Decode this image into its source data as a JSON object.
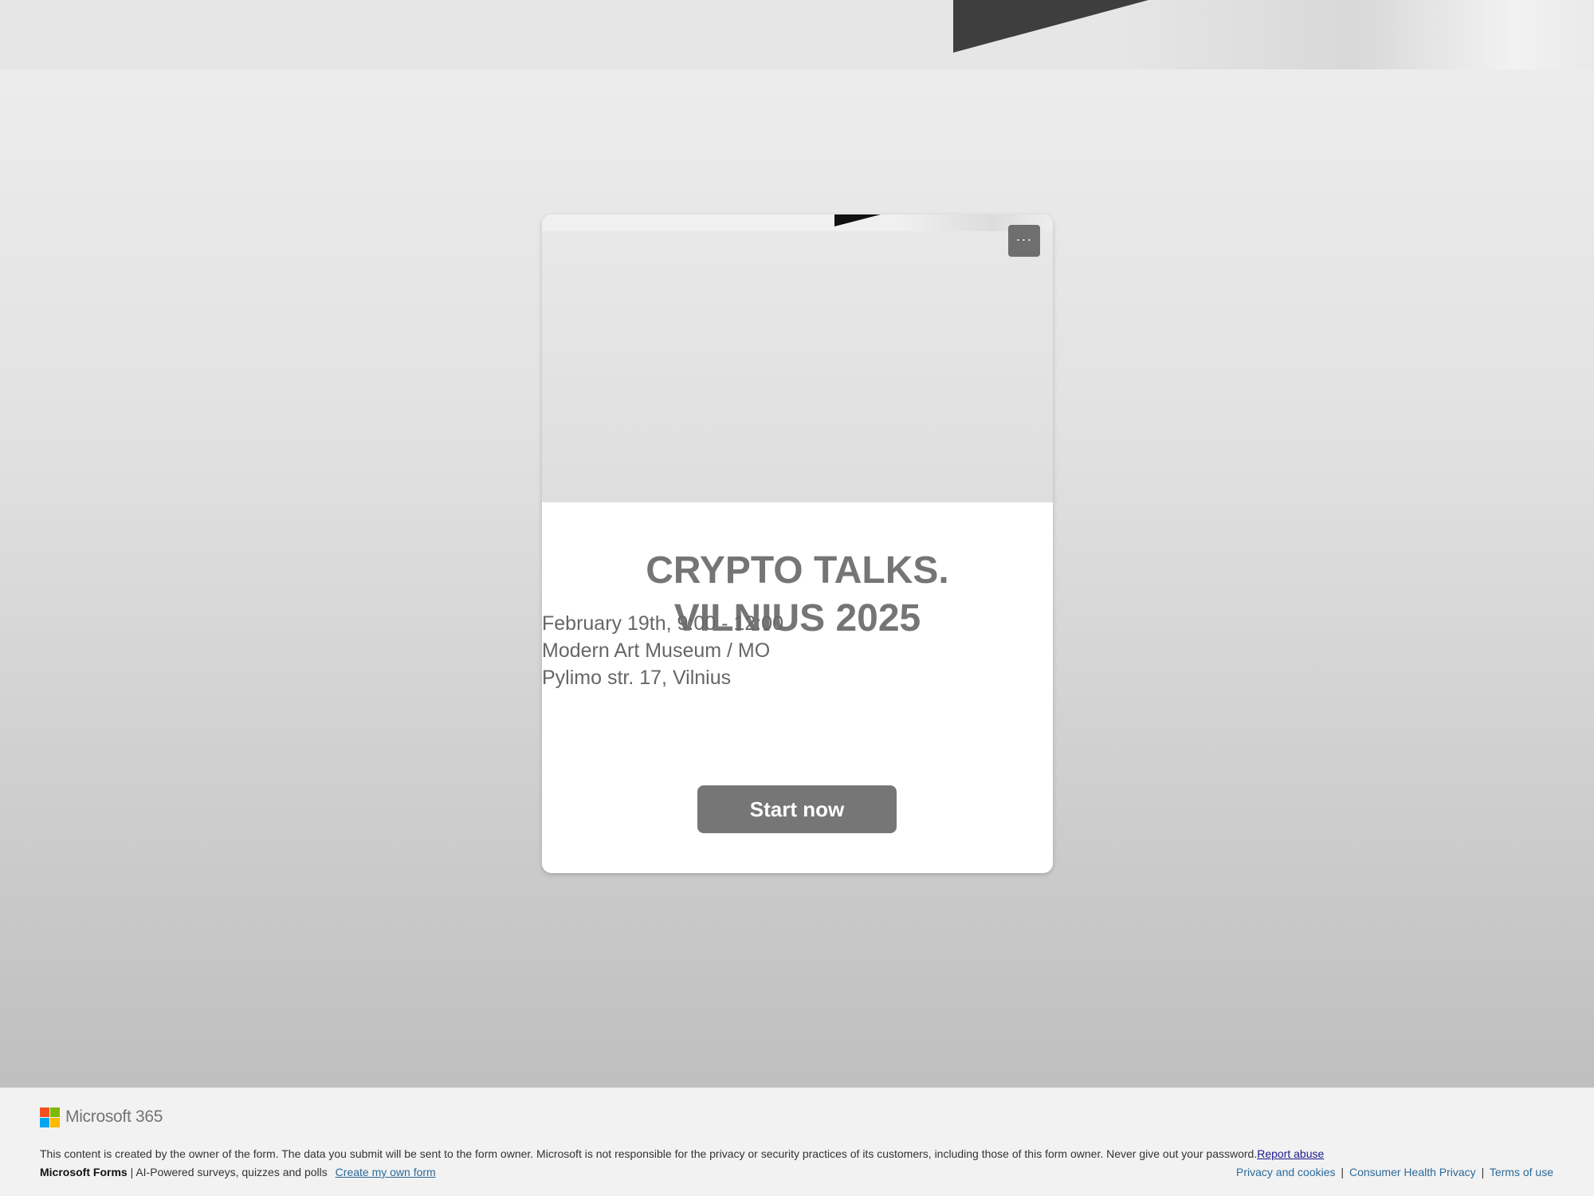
{
  "form": {
    "more_label": "···",
    "title_line1": "CRYPTO TALKS.",
    "title_line2": "VILNIUS 2025",
    "info_lines": [
      "February 19th, 9:00 - 12:00",
      "Modern Art Museum / MO",
      "Pylimo str. 17, Vilnius"
    ],
    "start_label": "Start now"
  },
  "footer": {
    "logo_text": "Microsoft 365",
    "disclaimer": "This content is created by the owner of the form. The data you submit will be sent to the form owner. Microsoft is not responsible for the privacy or security practices of its customers, including those of this form owner. Never give out your password.",
    "report_abuse": "Report abuse",
    "brand": "Microsoft Forms",
    "tagline": " | AI-Powered surveys, quizzes and polls",
    "create_link": "Create my own form",
    "links": [
      "Privacy and cookies",
      "Consumer Health Privacy",
      "Terms of use"
    ],
    "separator": "|"
  },
  "colors": {
    "button": "#767676",
    "title": "#757575",
    "link": "#2b6a99",
    "ms_red": "#f25022",
    "ms_green": "#7fba00",
    "ms_blue": "#00a4ef",
    "ms_yellow": "#ffb900"
  }
}
